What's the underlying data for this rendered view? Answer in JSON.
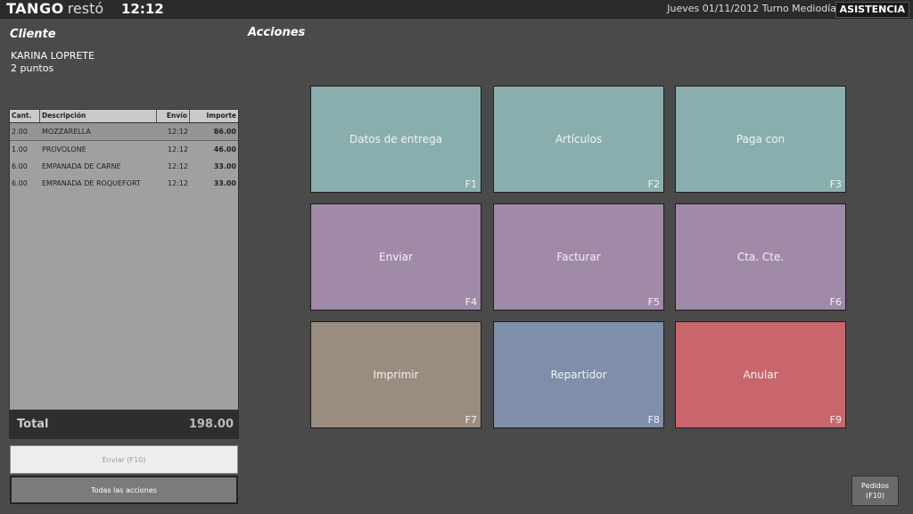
{
  "header": {
    "logo_bold": "TANGO",
    "logo_light": "restó",
    "time": "12:12",
    "shift_info": "Jueves 01/11/2012 Turno Mediodía",
    "assist_button": "ASISTENCIA"
  },
  "client": {
    "title": "Cliente",
    "name": "KARINA LOPRETE",
    "points": "2  puntos"
  },
  "order": {
    "columns": [
      "Cant.",
      "Descripción",
      "Envío",
      "Importe"
    ],
    "rows": [
      {
        "qty": "2.00",
        "desc": "MOZZARELLA",
        "time": "12:12",
        "amount": "86.00"
      },
      {
        "qty": "1.00",
        "desc": "PROVOLONE",
        "time": "12:12",
        "amount": "46.00"
      },
      {
        "qty": "6.00",
        "desc": "EMPANADA DE CARNE",
        "time": "12:12",
        "amount": "33.00"
      },
      {
        "qty": "6.00",
        "desc": "EMPANADA DE ROQUEFORT",
        "time": "12:12",
        "amount": "33.00"
      }
    ],
    "total_label": "Total",
    "total_value": "198.00",
    "send_button": "Enviar (F10)",
    "all_actions_button": "Todas las acciones"
  },
  "actions": {
    "title": "Acciones",
    "tiles": [
      {
        "label": "Datos de entrega",
        "key": "F1",
        "color": "#8aaeae"
      },
      {
        "label": "Artículos",
        "key": "F2",
        "color": "#8aaeae"
      },
      {
        "label": "Paga con",
        "key": "F3",
        "color": "#8aaeae"
      },
      {
        "label": "Enviar",
        "key": "F4",
        "color": "#a08aa8"
      },
      {
        "label": "Facturar",
        "key": "F5",
        "color": "#a08aa8"
      },
      {
        "label": "Cta. Cte.",
        "key": "F6",
        "color": "#a08aa8"
      },
      {
        "label": "Imprimir",
        "key": "F7",
        "color": "#9a8c7e"
      },
      {
        "label": "Repartidor",
        "key": "F8",
        "color": "#7f8ea9"
      },
      {
        "label": "Anular",
        "key": "F9",
        "color": "#c8666c"
      }
    ]
  },
  "footer": {
    "orders_line1": "Pedidos",
    "orders_line2": "(F10)"
  }
}
